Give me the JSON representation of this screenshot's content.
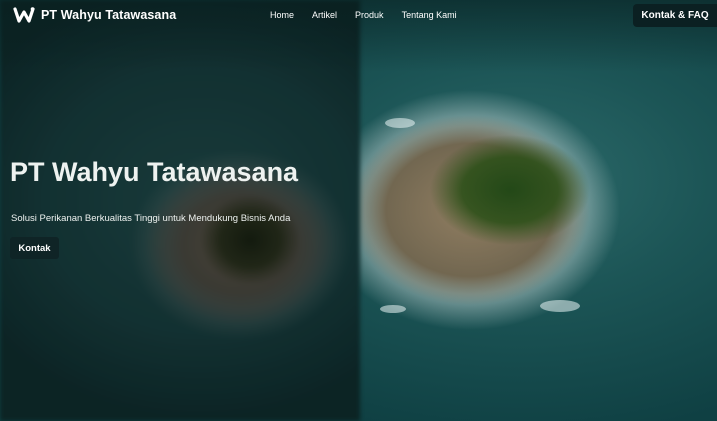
{
  "brand": {
    "name": "PT Wahyu Tatawasana",
    "logo_icon": "w-logo-icon"
  },
  "nav": {
    "items": [
      {
        "label": "Home"
      },
      {
        "label": "Artikel"
      },
      {
        "label": "Produk"
      },
      {
        "label": "Tentang Kami"
      }
    ],
    "cta_label": "Kontak & FAQ"
  },
  "hero": {
    "title": "PT Wahyu Tatawasana",
    "subtitle": "Solusi Perikanan Berkualitas Tinggi untuk Mendukung Bisnis Anda",
    "button_label": "Kontak",
    "background": "aerial-island-photo"
  },
  "colors": {
    "ocean": "#1c5556",
    "button_bg": "#0f2426",
    "text": "#eef2f0"
  }
}
